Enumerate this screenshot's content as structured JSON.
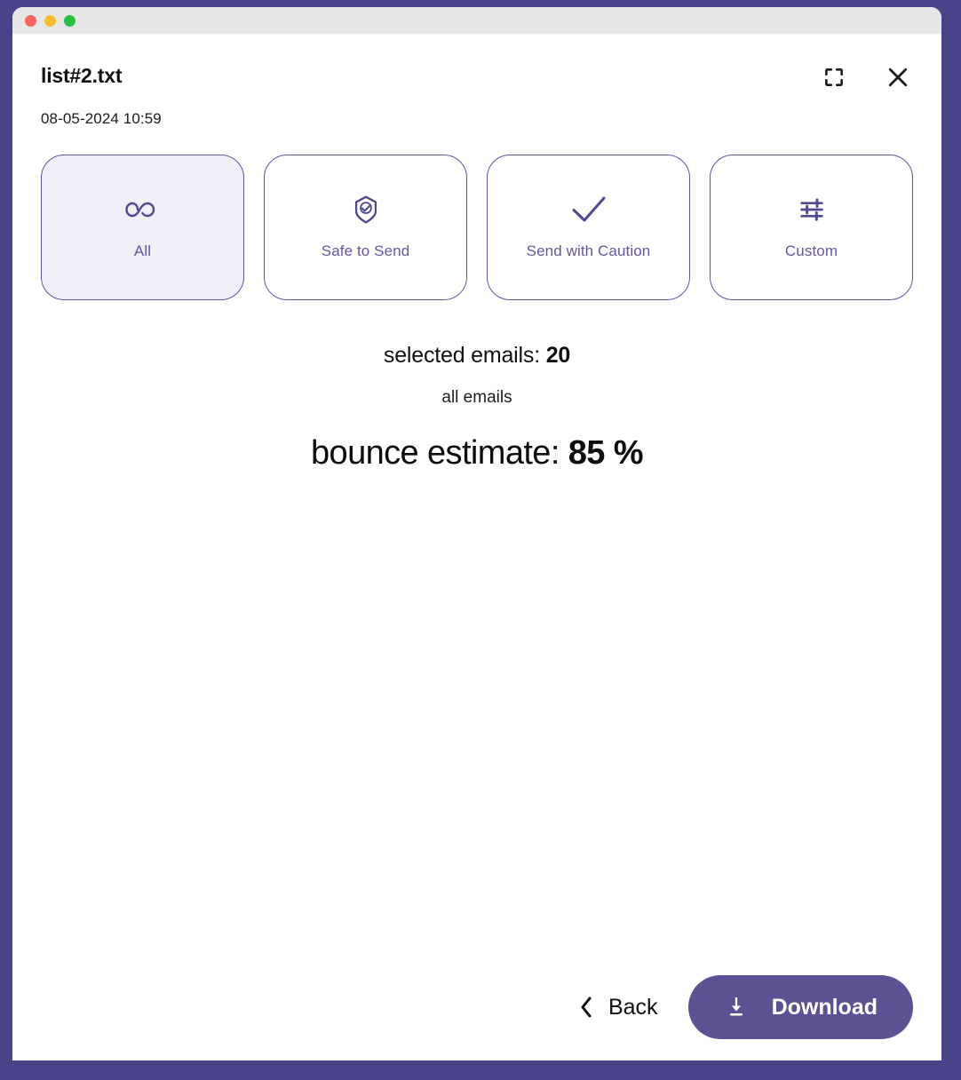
{
  "window": {
    "traffic_lights": [
      {
        "name": "close",
        "color": "#f9655b"
      },
      {
        "name": "minimize",
        "color": "#fcbc2d"
      },
      {
        "name": "maximize",
        "color": "#2ac140"
      }
    ],
    "desktop_background": "#4a4389"
  },
  "header": {
    "file_title": "list#2.txt",
    "timestamp": "08-05-2024 10:59",
    "expand_icon": "expand-icon",
    "close_icon": "close-icon"
  },
  "filters": {
    "cards": [
      {
        "label": "All",
        "icon": "infinity-icon",
        "selected": true
      },
      {
        "label": "Safe to Send",
        "icon": "shield-check-icon",
        "selected": false
      },
      {
        "label": "Send with Caution",
        "icon": "check-icon",
        "selected": false
      },
      {
        "label": "Custom",
        "icon": "sliders-icon",
        "selected": false
      }
    ],
    "accent_color": "#5b54a0",
    "selected_fill": "#f0eef7",
    "label_color": "#5f58a3"
  },
  "stats": {
    "selected_label": "selected emails: ",
    "selected_value": "20",
    "scope": "all emails",
    "bounce_label": "bounce estimate: ",
    "bounce_value": "85 %"
  },
  "footer": {
    "back_label": "Back",
    "back_icon": "chevron-left-icon",
    "download_label": "Download",
    "download_icon": "download-icon",
    "download_color": "#5a5292"
  }
}
